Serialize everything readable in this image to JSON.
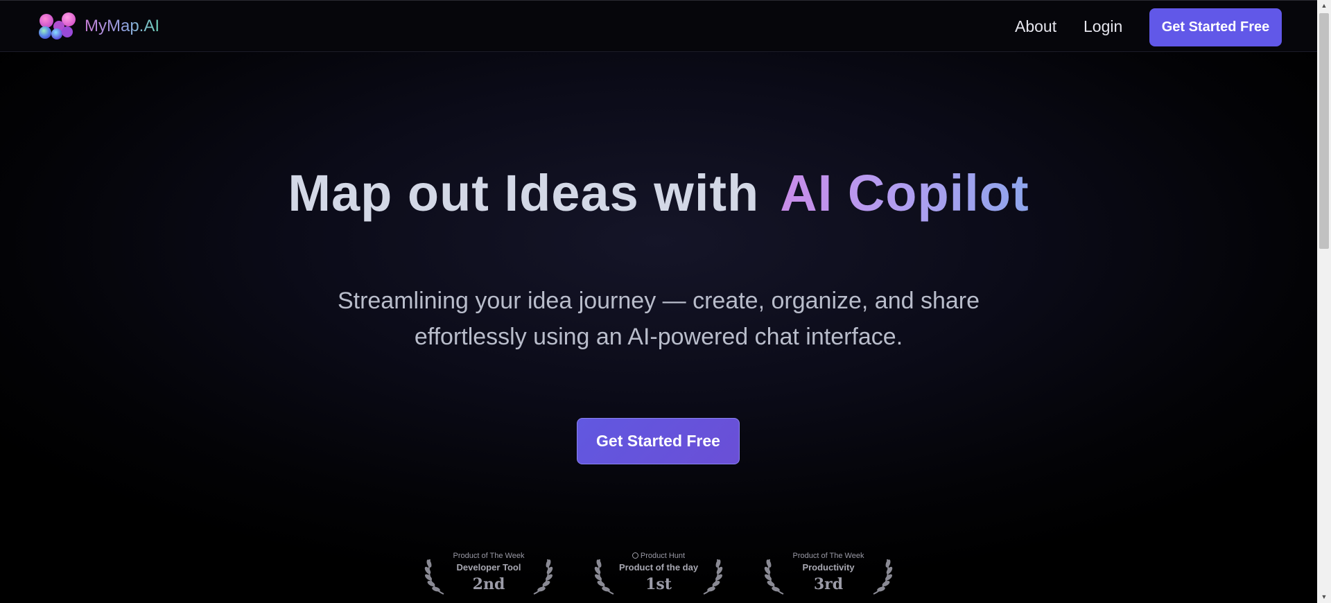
{
  "brand": {
    "name": "MyMap.AI"
  },
  "nav": {
    "about": "About",
    "login": "Login",
    "cta": "Get Started Free"
  },
  "hero": {
    "title_plain": "Map out Ideas with",
    "title_highlight": "AI Copilot",
    "subtitle_line1": "Streamlining your idea journey — create, organize, and share",
    "subtitle_line2": "effortlessly using an AI-powered chat interface.",
    "cta": "Get Started Free"
  },
  "badges": [
    {
      "top": "Product of The Week",
      "category": "Developer Tool",
      "rank": "2nd"
    },
    {
      "top": "Product Hunt",
      "category": "Product of the day",
      "rank": "1st"
    },
    {
      "top": "Product of The Week",
      "category": "Productivity",
      "rank": "3rd"
    }
  ],
  "colors": {
    "accent": "#6158e8",
    "background": "#0b0b18",
    "title_gradient_start": "#c98ce8",
    "title_gradient_end": "#8ea6ec"
  },
  "icons": {
    "logo": "mymap-logo-icon",
    "laurel": "laurel-wreath-icon",
    "product_hunt": "product-hunt-icon",
    "scroll_up": "scroll-up-arrow-icon",
    "scroll_down": "scroll-down-arrow-icon"
  }
}
